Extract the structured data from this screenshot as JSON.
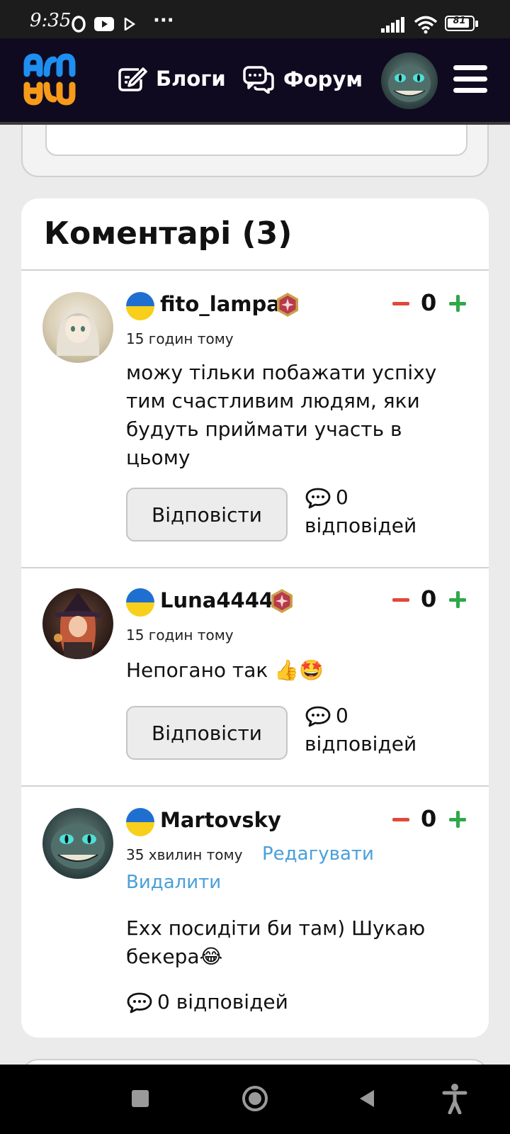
{
  "status_bar": {
    "time": "9:35",
    "battery": "81",
    "overflow": "···"
  },
  "header": {
    "nav": [
      {
        "label": "Блоги",
        "icon": "edit-icon"
      },
      {
        "label": "Форум",
        "icon": "chat-bubbles-icon"
      }
    ]
  },
  "comments_section": {
    "title": "Коментарі (3)",
    "reply_label": "Відповісти",
    "comments": [
      {
        "username": "fito_lampa",
        "flag": "ukraine-flag",
        "time": "15 годин тому",
        "text": "можу тільки побажати успіху тим счастливим людям, яки будуть приймати участь в цьому",
        "votes": "0",
        "replies_count": "0",
        "replies_word": "відповідей"
      },
      {
        "username": "Luna4444",
        "flag": "ukraine-flag",
        "time": "15 годин тому",
        "text": "Непогано так 👍🤩",
        "votes": "0",
        "replies_count": "0",
        "replies_word": "відповідей"
      },
      {
        "username": "Martovsky",
        "flag": "ukraine-flag",
        "time": "35 хвилин тому",
        "edit_label": "Редагувати",
        "delete_label": "Видалити",
        "text": "Ехх посидіти би там) Шукаю бекера😂",
        "votes": "0",
        "replies_text": "0 відповідей"
      }
    ]
  },
  "colors": {
    "header_bg": "#0f0a20",
    "vote_minus": "#e0493b",
    "vote_plus": "#2fa84a",
    "link": "#4a9fd9",
    "logo_blue": "#1e8ff0",
    "logo_orange": "#f79a1a"
  }
}
